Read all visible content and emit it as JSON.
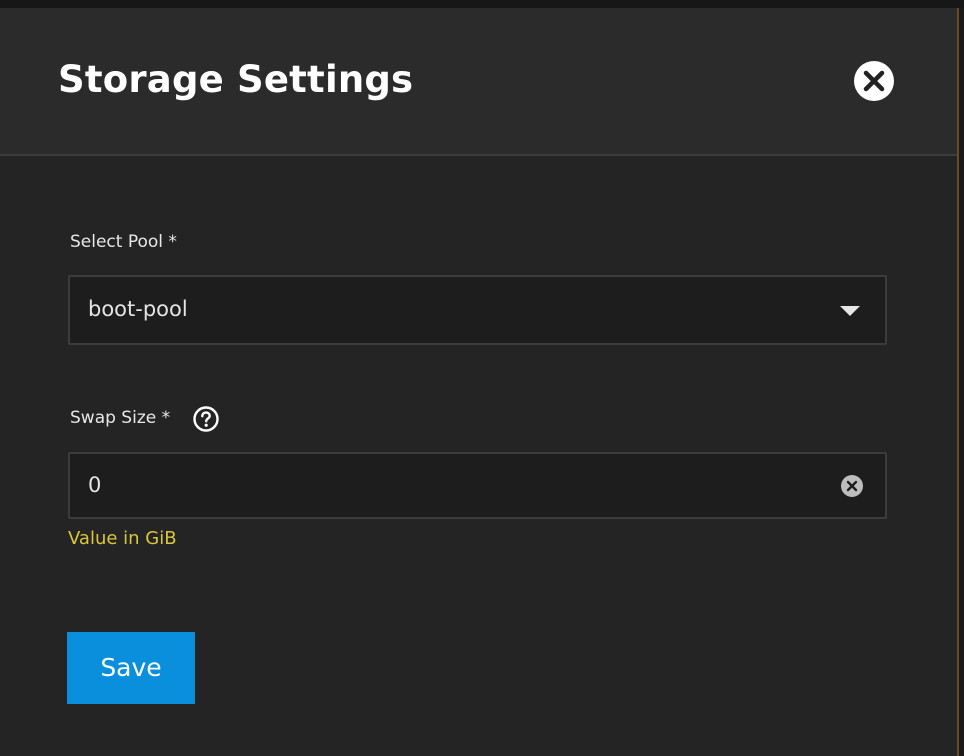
{
  "dialog": {
    "title": "Storage Settings",
    "close_icon": "close-icon"
  },
  "pool_field": {
    "label": "Select Pool *",
    "selected_value": "boot-pool",
    "dropdown_icon": "chevron-down-icon"
  },
  "swap_field": {
    "label": "Swap Size *",
    "help_icon": "help-circle-icon",
    "value": "0",
    "clear_icon": "clear-icon",
    "hint": "Value in GiB"
  },
  "actions": {
    "save_label": "Save"
  },
  "colors": {
    "background": "#242424",
    "header_background": "#2b2b2b",
    "field_background": "#1d1d1d",
    "hint_text": "#d9c63c",
    "primary_button": "#0a8fdc"
  }
}
